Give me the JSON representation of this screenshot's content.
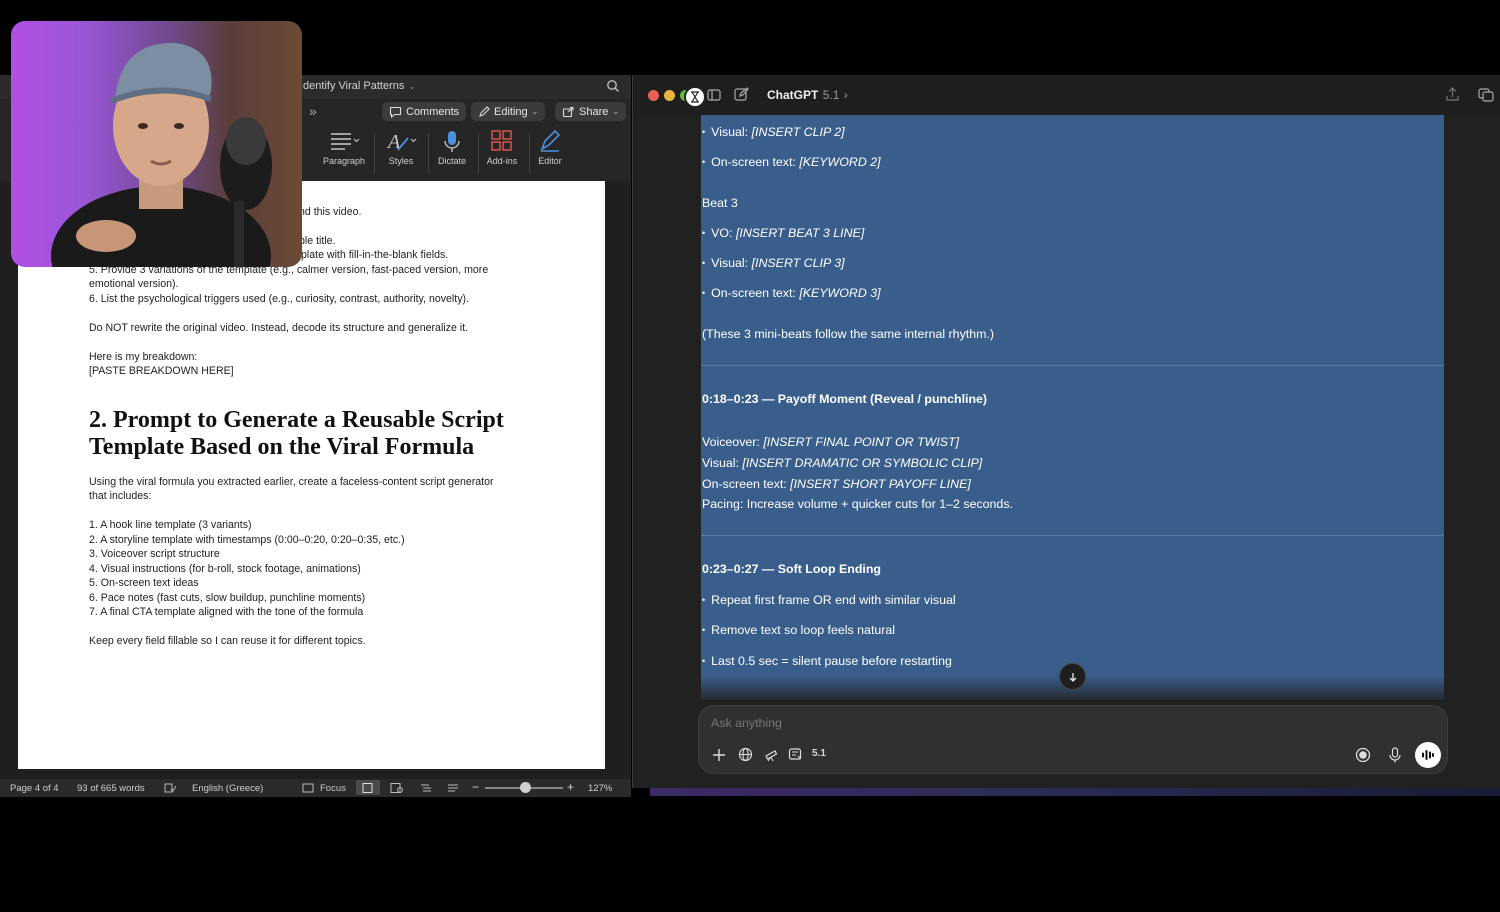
{
  "word": {
    "title": "Identify Viral Patterns",
    "tab_more": "»",
    "buttons": {
      "comments": "Comments",
      "editing": "Editing",
      "share": "Share"
    },
    "ribbon": [
      "Paragraph",
      "Styles",
      "Dictate",
      "Add-ins",
      "Editor"
    ],
    "doc": {
      "lines_top": [
        "nd this video.",
        "ble title.",
        "plate with fill-in-the-blank fields.",
        "5. Provide 3 variations of the template (e.g., calmer version, fast-paced version, more",
        "emotional version).",
        "6. List the psychological triggers used (e.g., curiosity, contrast, authority, novelty).",
        "Do NOT rewrite the original video. Instead, decode its structure and generalize it.",
        "Here is my breakdown:",
        "[PASTE BREAKDOWN HERE]"
      ],
      "heading_line1": "2. Prompt to Generate a Reusable Script",
      "heading_line2": "Template Based on the Viral Formula",
      "intro_1": "Using the viral formula you extracted earlier, create a faceless-content script generator",
      "intro_2": "that includes:",
      "list": [
        "1. A hook line template (3 variants)",
        "2. A storyline template with timestamps (0:00–0:20, 0:20–0:35, etc.)",
        "3. Voiceover script structure",
        "4. Visual instructions (for b-roll, stock footage, animations)",
        "5. On-screen text ideas",
        "6. Pace notes (fast cuts, slow buildup, punchline moments)",
        "7. A final CTA template aligned with the tone of the formula"
      ],
      "closing": "Keep every field fillable so I can reuse it for different topics."
    },
    "status": {
      "page": "Page 4 of 4",
      "words": "93 of 665 words",
      "language": "English (Greece)",
      "focus": "Focus",
      "zoom": "127%"
    }
  },
  "chatgpt": {
    "title": "ChatGPT",
    "version": "5.1",
    "content": {
      "b2_visual_label": "Visual: ",
      "b2_visual_value": "[INSERT CLIP 2]",
      "b2_text_label": "On-screen text: ",
      "b2_text_value": "[KEYWORD 2]",
      "beat3": "Beat 3",
      "b3_vo_label": "VO: ",
      "b3_vo_value": "[INSERT BEAT 3 LINE]",
      "b3_visual_label": "Visual: ",
      "b3_visual_value": "[INSERT CLIP 3]",
      "b3_text_label": "On-screen text: ",
      "b3_text_value": "[KEYWORD 3]",
      "beats_note": "(These 3 mini-beats follow the same internal rhythm.)",
      "payoff_heading": "0:18–0:23 — Payoff Moment (Reveal / punchline)",
      "payoff_vo_label": "Voiceover: ",
      "payoff_vo_value": "[INSERT FINAL POINT OR TWIST]",
      "payoff_visual_label": "Visual: ",
      "payoff_visual_value": "[INSERT DRAMATIC OR SYMBOLIC CLIP]",
      "payoff_text_label": "On-screen text: ",
      "payoff_text_value": "[INSERT SHORT PAYOFF LINE]",
      "payoff_pacing": "Pacing: Increase volume + quicker cuts for 1–2 seconds.",
      "loop_heading": "0:23–0:27 — Soft Loop Ending",
      "loop_items": [
        "Repeat first frame OR end with similar visual",
        "Remove text so loop feels natural",
        "Last 0.5 sec = silent pause before restarting"
      ]
    },
    "composer": {
      "placeholder": "Ask anything",
      "model": "5.1"
    }
  }
}
